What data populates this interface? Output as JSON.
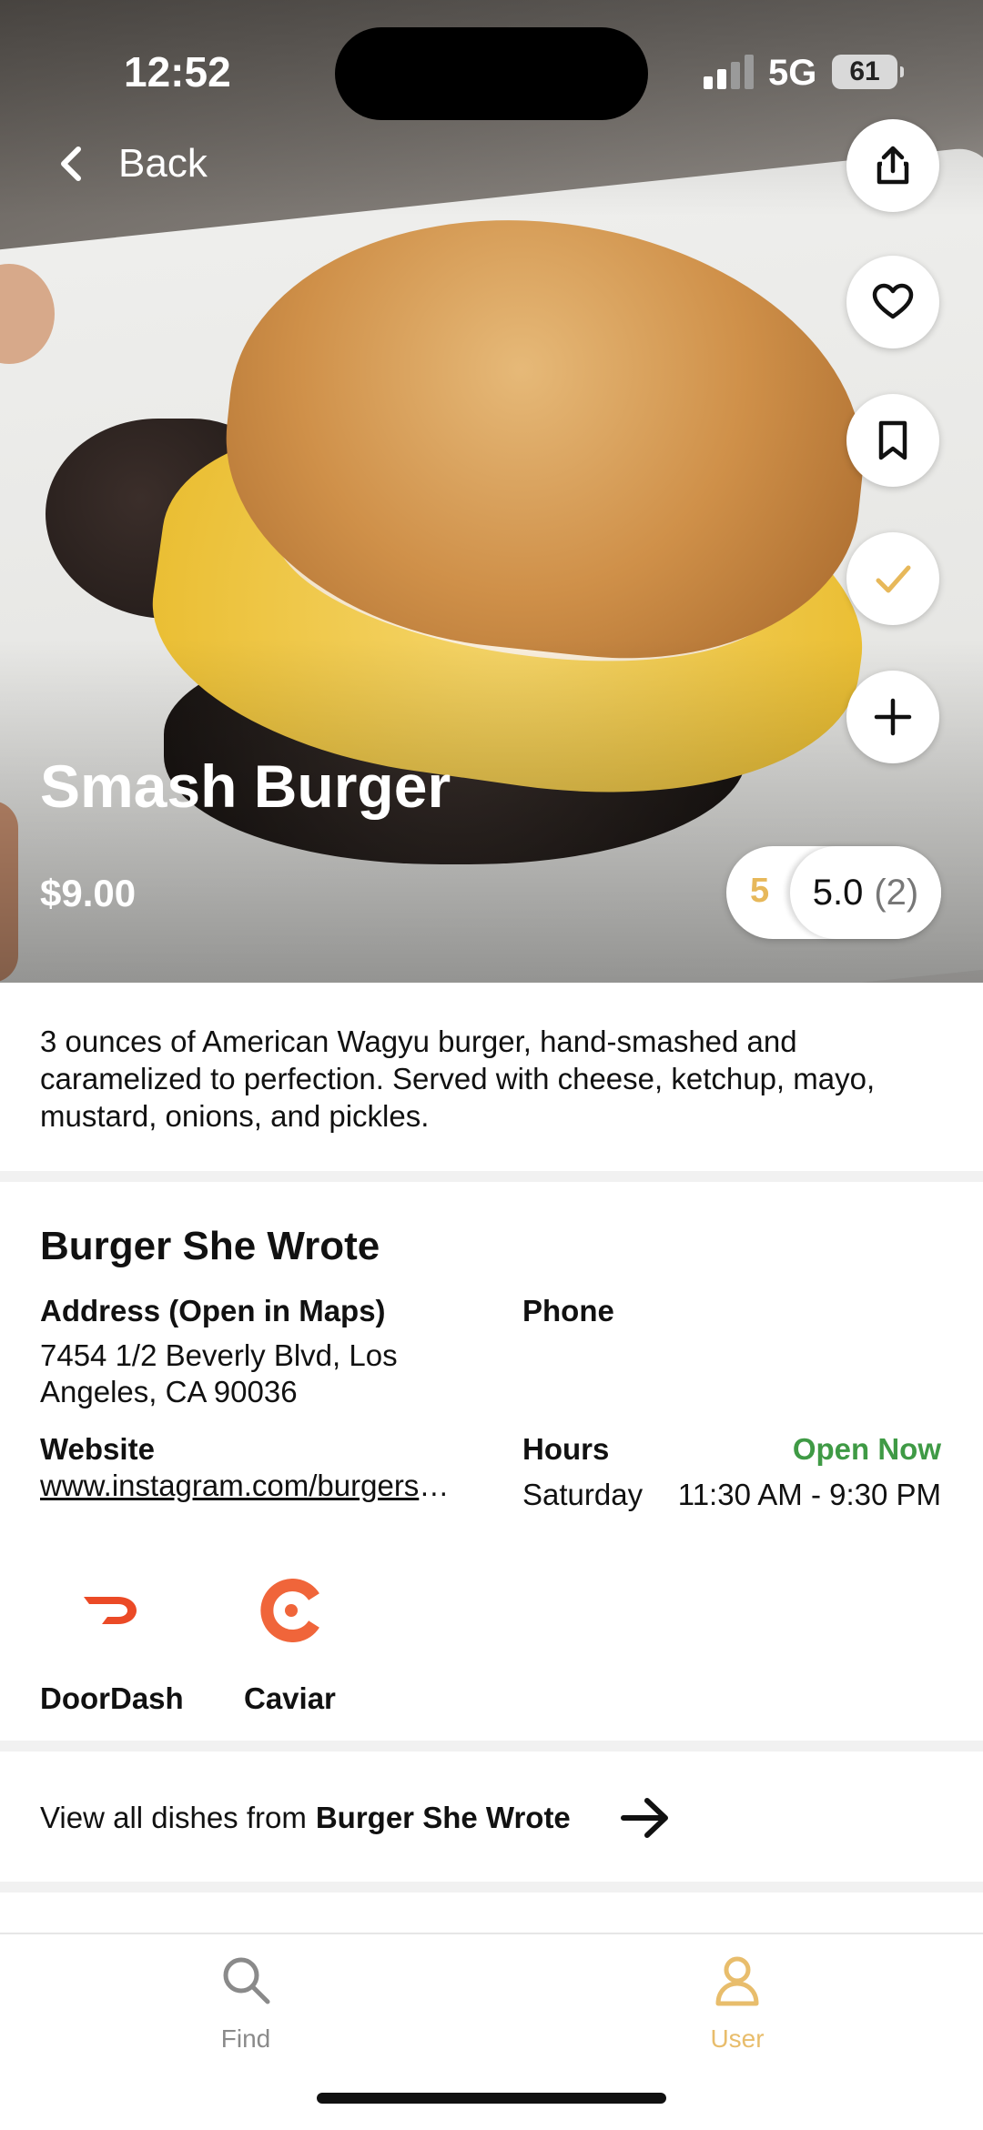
{
  "status_bar": {
    "time": "12:52",
    "network": "5G",
    "battery": "61"
  },
  "nav": {
    "back_label": "Back"
  },
  "dish": {
    "title": "Smash Burger",
    "price": "$9.00",
    "my_rating": "5",
    "average_rating": "5.0",
    "rating_count": "(2)",
    "description": "3 ounces of American Wagyu burger, hand-smashed and caramelized to perfection. Served with cheese, ketchup, mayo, mustard, onions, and pickles."
  },
  "actions": {
    "share_icon": "share-icon",
    "favorite_icon": "heart-icon",
    "bookmark_icon": "bookmark-icon",
    "tried_icon": "check-icon",
    "add_icon": "plus-icon",
    "tried_color": "#e7b85a"
  },
  "restaurant": {
    "name": "Burger She Wrote",
    "address_label": "Address (Open in Maps)",
    "address_line1": "7454 1/2 Beverly Blvd, Los",
    "address_line2": "Angeles, CA 90036",
    "phone_label": "Phone",
    "website_label": "Website",
    "website": "www.instagram.com/burgershewrote",
    "hours_label": "Hours",
    "open_status": "Open Now",
    "open_color": "#3f9a45",
    "hours_day": "Saturday",
    "hours_time": "11:30 AM - 9:30 PM"
  },
  "delivery": [
    {
      "name": "DoorDash",
      "icon": "doordash-icon",
      "color": "#eb4a26"
    },
    {
      "name": "Caviar",
      "icon": "caviar-icon",
      "color": "#f0653a"
    }
  ],
  "view_all": {
    "prefix": "View all dishes from",
    "restaurant": "Burger She Wrote"
  },
  "tabbar": {
    "find_label": "Find",
    "user_label": "User",
    "active_color": "#e8bd6c",
    "inactive_color": "#8a8a8a"
  }
}
